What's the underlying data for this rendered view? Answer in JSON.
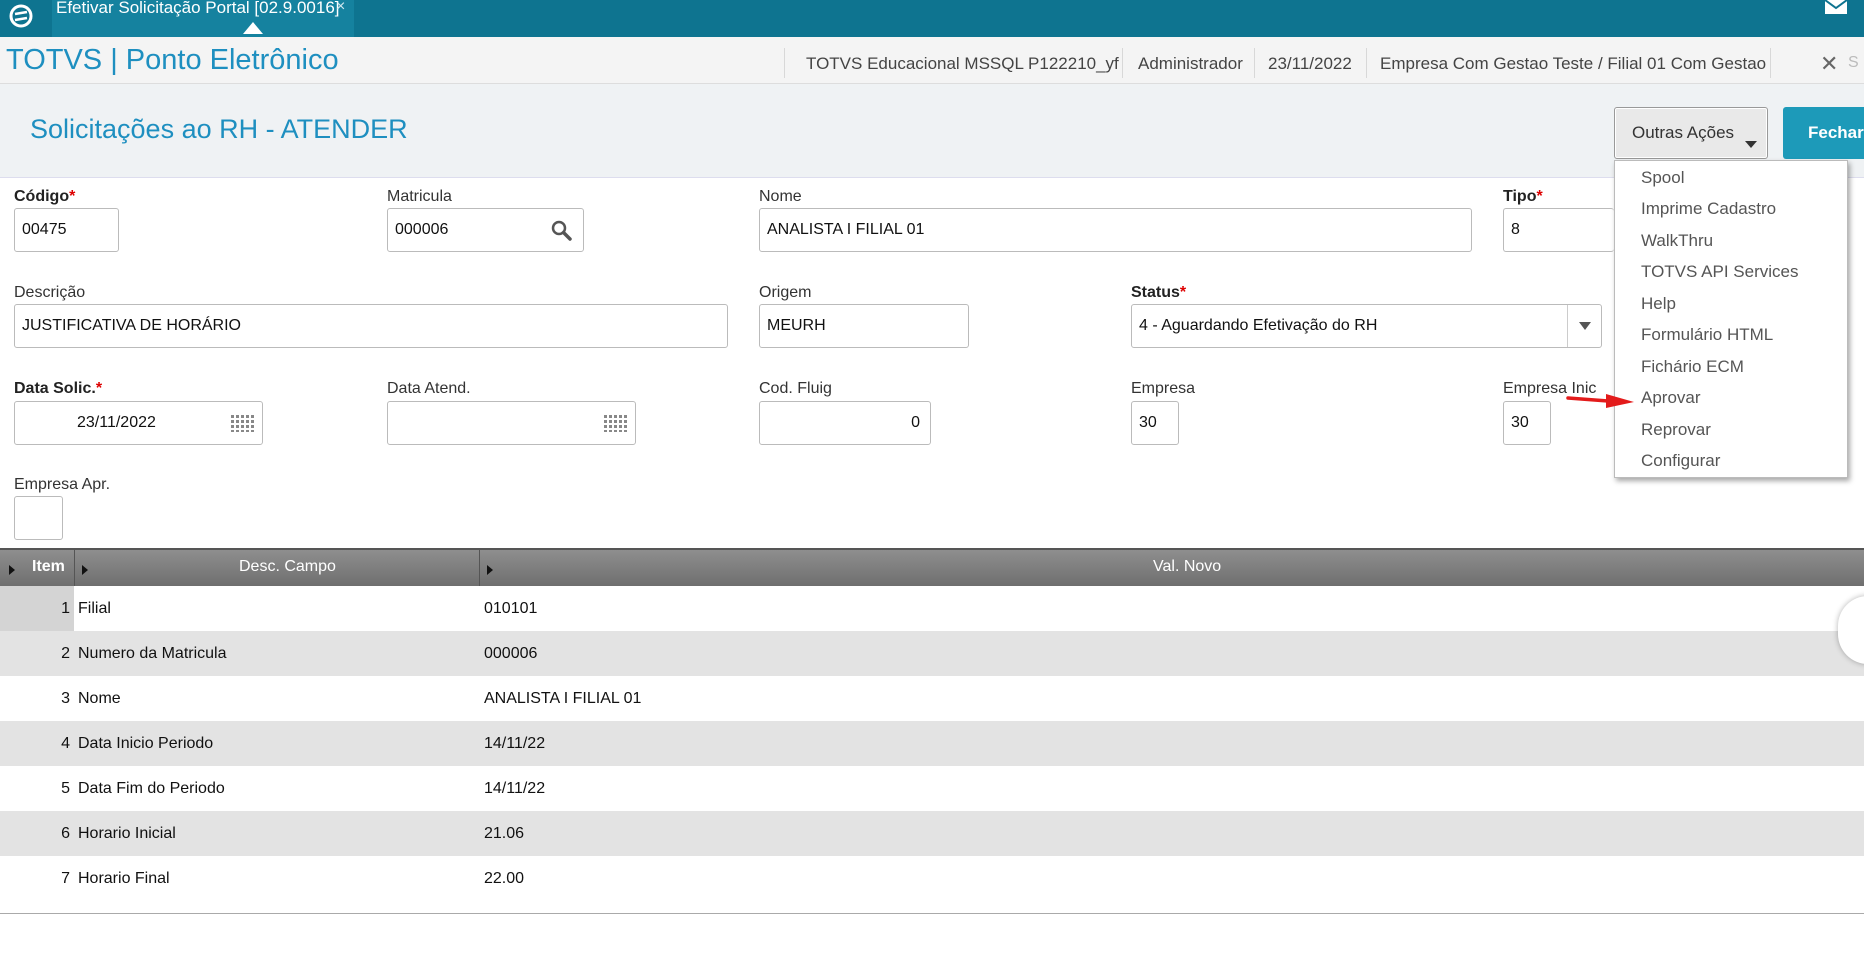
{
  "window": {
    "tab_title": "Efetivar Solicitação Portal [02.9.0016]",
    "tab_close": "×"
  },
  "header": {
    "app_title": "TOTVS | Ponto Eletrônico",
    "environment": "TOTVS Educacional MSSQL P122210_yf",
    "user": "Administrador",
    "date": "23/11/2022",
    "company": "Empresa Com Gestao Teste / Filial 01 Com Gestao",
    "close_icon": "✕",
    "close_label": "S"
  },
  "page": {
    "title": "Solicitações ao RH - ATENDER"
  },
  "actions": {
    "outras_label": "Outras Ações",
    "fechar_label": "Fechar",
    "menu": [
      "Spool",
      "Imprime Cadastro",
      "WalkThru",
      "TOTVS API Services",
      "Help",
      "Formulário HTML",
      "Fichário ECM",
      "Aprovar",
      "Reprovar",
      "Configurar"
    ]
  },
  "form": {
    "codigo": {
      "label": "Código",
      "value": "00475"
    },
    "matricula": {
      "label": "Matricula",
      "value": "000006"
    },
    "nome": {
      "label": "Nome",
      "value": "ANALISTA I FILIAL 01"
    },
    "tipo": {
      "label": "Tipo",
      "value": "8"
    },
    "descricao": {
      "label": "Descrição",
      "value": "JUSTIFICATIVA DE HORÁRIO"
    },
    "origem": {
      "label": "Origem",
      "value": "MEURH"
    },
    "status": {
      "label": "Status",
      "value": "4 - Aguardando Efetivação do RH"
    },
    "data_solic": {
      "label": "Data Solic.",
      "value": "23/11/2022"
    },
    "data_atend": {
      "label": "Data Atend.",
      "value": " /  /"
    },
    "cod_fluig": {
      "label": "Cod. Fluig",
      "value": "0"
    },
    "empresa": {
      "label": "Empresa",
      "value": "30"
    },
    "empresa_inic": {
      "label": "Empresa Inic",
      "value": "30"
    },
    "empresa_apr": {
      "label": "Empresa Apr.",
      "value": ""
    },
    "required_mark": "*"
  },
  "grid": {
    "columns": [
      "Item",
      "Desc. Campo",
      "Val. Novo"
    ],
    "rows": [
      {
        "item": "1",
        "desc": "Filial",
        "val": "010101"
      },
      {
        "item": "2",
        "desc": "Numero da Matricula",
        "val": "000006"
      },
      {
        "item": "3",
        "desc": "Nome",
        "val": "ANALISTA I FILIAL 01"
      },
      {
        "item": "4",
        "desc": "Data Inicio Periodo",
        "val": "14/11/22"
      },
      {
        "item": "5",
        "desc": "Data Fim do Periodo",
        "val": "14/11/22"
      },
      {
        "item": "6",
        "desc": "Horario Inicial",
        "val": "21.06"
      },
      {
        "item": "7",
        "desc": "Horario Final",
        "val": "22.00"
      }
    ]
  },
  "colors": {
    "topbar": "#0e7490",
    "accent": "#1e8fc0",
    "button": "#1d9ab9",
    "arrow": "#e31b1b"
  }
}
